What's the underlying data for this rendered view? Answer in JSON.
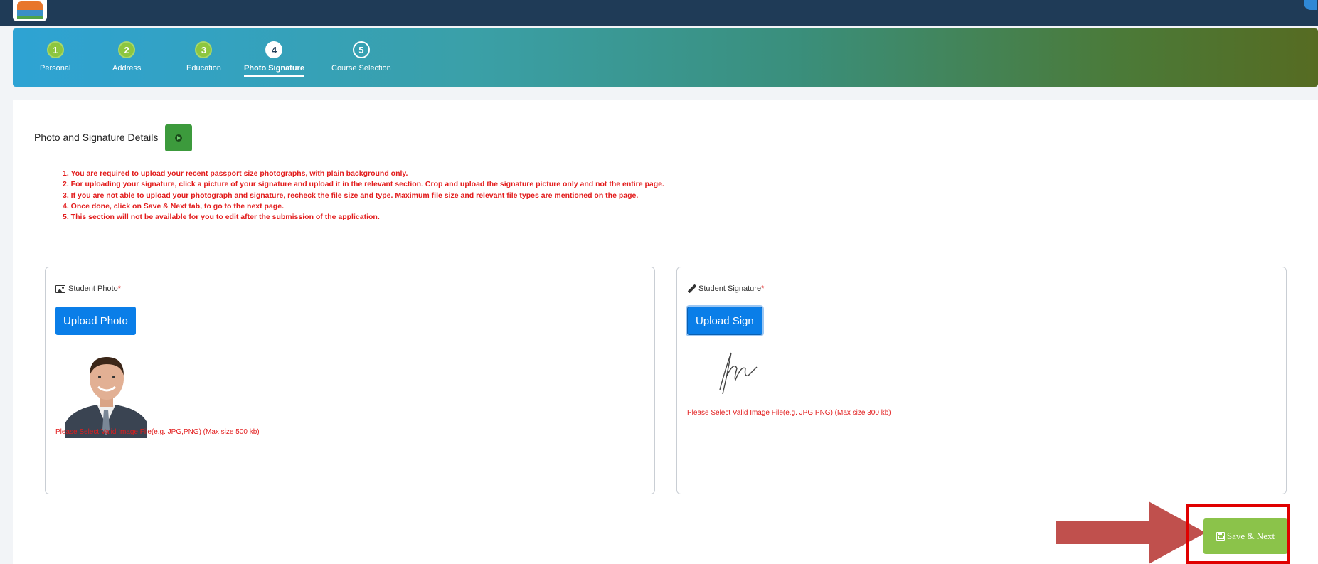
{
  "stepper": {
    "steps": [
      {
        "num": "1",
        "label": "Personal",
        "state": "done"
      },
      {
        "num": "2",
        "label": "Address",
        "state": "done"
      },
      {
        "num": "3",
        "label": "Education",
        "state": "done"
      },
      {
        "num": "4",
        "label": "Photo Signature",
        "state": "current"
      },
      {
        "num": "5",
        "label": "Course Selection",
        "state": "todo"
      }
    ]
  },
  "section": {
    "title": "Photo and Signature Details",
    "instructions": [
      "1. You are required to upload your recent passport size photographs, with plain background only.",
      "2. For uploading your signature, click a picture of your signature and upload it in the relevant section. Crop and upload the signature picture only and not the entire page.",
      "3. If you are not able to upload your photograph and signature, recheck the file size and type. Maximum file size and relevant file types are mentioned on the page.",
      "4. Once done, click on Save & Next tab, to go to the next page.",
      "5. This section will not be available for you to edit after the submission of the application."
    ]
  },
  "photo": {
    "label": "Student Photo",
    "required_mark": "*",
    "button": "Upload Photo",
    "hint": "Please Select Valid Image File(e.g. JPG,PNG) (Max size 500 kb)",
    "icon": "image-icon"
  },
  "signature": {
    "label": "Student Signature",
    "required_mark": "*",
    "button": "Upload Sign",
    "hint": "Please Select Valid Image File(e.g. JPG,PNG) (Max size 300 kb)",
    "icon": "pencil-icon"
  },
  "actions": {
    "save_next": "Save & Next",
    "save_icon": "floppy-disk-icon"
  },
  "colors": {
    "topbar": "#1f3b57",
    "instruction_text": "#e21c1c",
    "upload_button": "#0a7ee8",
    "save_button": "#8bc34a",
    "highlight_frame": "#e00000",
    "arrow": "#c0504d"
  }
}
